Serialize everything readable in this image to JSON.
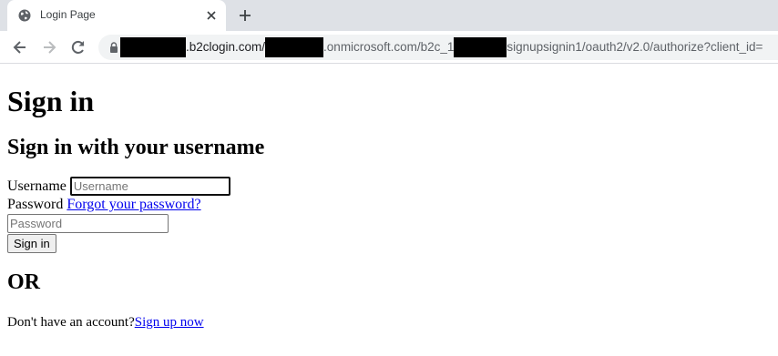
{
  "browser": {
    "tab_title": "Login Page",
    "url": {
      "part1": ".b2clogin.com/",
      "part2": ".onmicrosoft.com/b2c_1",
      "part3": "signupsignin1/oauth2/v2.0/authorize?client_id="
    }
  },
  "page": {
    "heading": "Sign in",
    "subheading": "Sign in with your username",
    "username_label": "Username",
    "username_placeholder": "Username",
    "password_label": "Password",
    "forgot_link": "Forgot your password?",
    "password_placeholder": "Password",
    "signin_button": "Sign in",
    "or_heading": "OR",
    "no_account_text": "Don't have an account?",
    "signup_link": "Sign up now"
  }
}
